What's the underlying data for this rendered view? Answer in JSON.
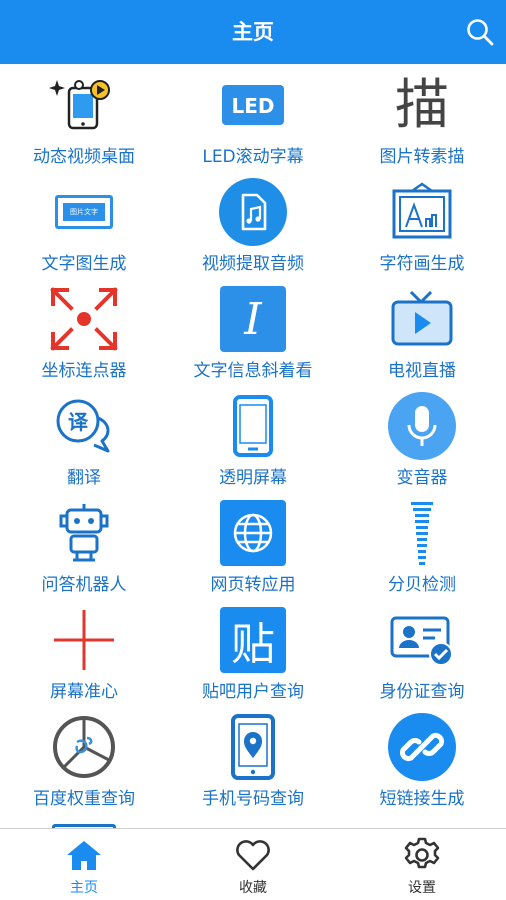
{
  "header": {
    "title": "主页"
  },
  "items": [
    {
      "label": "动态视频桌面",
      "icon": "live-wallpaper-icon"
    },
    {
      "label": "LED滚动字幕",
      "icon": "led-icon"
    },
    {
      "label": "图片转素描",
      "icon": "sketch-glyph-icon",
      "glyph": "描"
    },
    {
      "label": "文字图生成",
      "icon": "text-image-icon",
      "glyph": "图片文字"
    },
    {
      "label": "视频提取音频",
      "icon": "audio-file-icon"
    },
    {
      "label": "字符画生成",
      "icon": "painting-frame-icon"
    },
    {
      "label": "坐标连点器",
      "icon": "expand-arrows-icon"
    },
    {
      "label": "文字信息斜着看",
      "icon": "italic-icon",
      "glyph": "I"
    },
    {
      "label": "电视直播",
      "icon": "tv-icon"
    },
    {
      "label": "翻译",
      "icon": "translate-bubble-icon",
      "glyph": "译"
    },
    {
      "label": "透明屏幕",
      "icon": "phone-icon"
    },
    {
      "label": "变音器",
      "icon": "microphone-icon"
    },
    {
      "label": "问答机器人",
      "icon": "robot-icon"
    },
    {
      "label": "网页转应用",
      "icon": "globe-icon"
    },
    {
      "label": "分贝检测",
      "icon": "decibel-bars-icon"
    },
    {
      "label": "屏幕准心",
      "icon": "crosshair-icon"
    },
    {
      "label": "贴吧用户查询",
      "icon": "tieba-glyph-icon",
      "glyph": "贴"
    },
    {
      "label": "身份证查询",
      "icon": "id-card-icon"
    },
    {
      "label": "百度权重查询",
      "icon": "pie-weight-icon"
    },
    {
      "label": "手机号码查询",
      "icon": "phone-location-icon"
    },
    {
      "label": "短链接生成",
      "icon": "link-icon"
    }
  ],
  "bottom_nav": [
    {
      "label": "主页",
      "icon": "home-icon",
      "active": true
    },
    {
      "label": "收藏",
      "icon": "heart-icon",
      "active": false
    },
    {
      "label": "设置",
      "icon": "gear-icon",
      "active": false
    }
  ],
  "colors": {
    "primary": "#1a8cf0",
    "label": "#1a73c8",
    "nav_inactive": "#333333",
    "red": "#e5352b"
  }
}
